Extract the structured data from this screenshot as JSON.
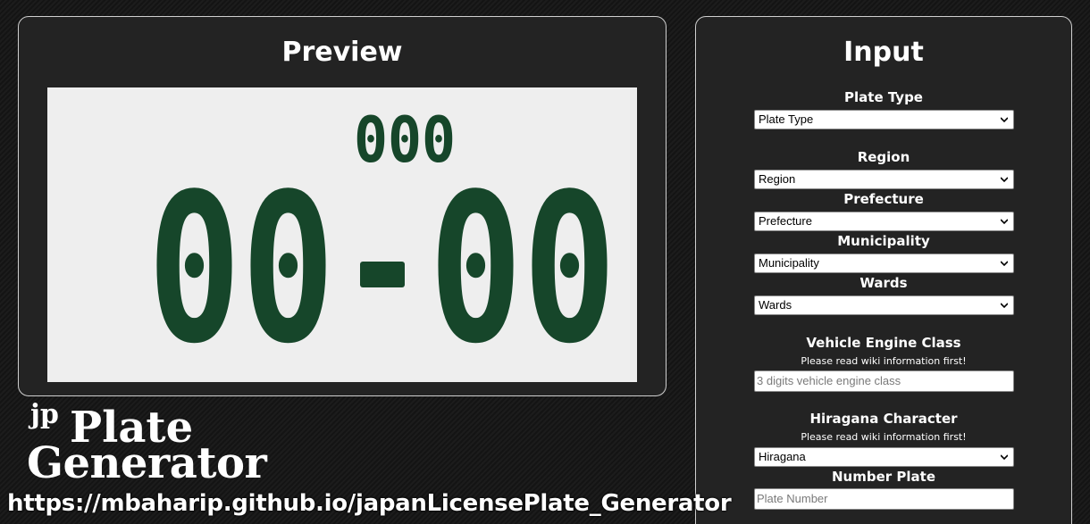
{
  "preview": {
    "title": "Preview",
    "plate": {
      "top_number": "000",
      "main_left": "00",
      "main_right": "00",
      "plate_color": "#eeeeee",
      "text_color": "#16462a"
    }
  },
  "input": {
    "title": "Input",
    "plate_type": {
      "label": "Plate Type",
      "selected": "Plate Type"
    },
    "region": {
      "label": "Region",
      "selected": "Region"
    },
    "prefecture": {
      "label": "Prefecture",
      "selected": "Prefecture"
    },
    "municipality": {
      "label": "Municipality",
      "selected": "Municipality"
    },
    "wards": {
      "label": "Wards",
      "selected": "Wards"
    },
    "engine_class": {
      "label": "Vehicle Engine Class",
      "note": "Please read wiki information first!",
      "placeholder": "3 digits vehicle engine class"
    },
    "hiragana": {
      "label": "Hiragana Character",
      "note": "Please read wiki information first!",
      "selected": "Hiragana"
    },
    "number_plate": {
      "label": "Number Plate",
      "placeholder": "Plate Number"
    }
  },
  "branding": {
    "logo_jp": "jp",
    "logo_plate": "Plate",
    "logo_generator": "Generator",
    "url": "https://mbaharip.github.io/japanLicensePlate_Generator"
  },
  "icons": {
    "dropdown": "chevron-down-icon"
  },
  "colors": {
    "background": "#1a1a1a",
    "panel": "#232323",
    "panel_border": "#cfcfcf"
  }
}
